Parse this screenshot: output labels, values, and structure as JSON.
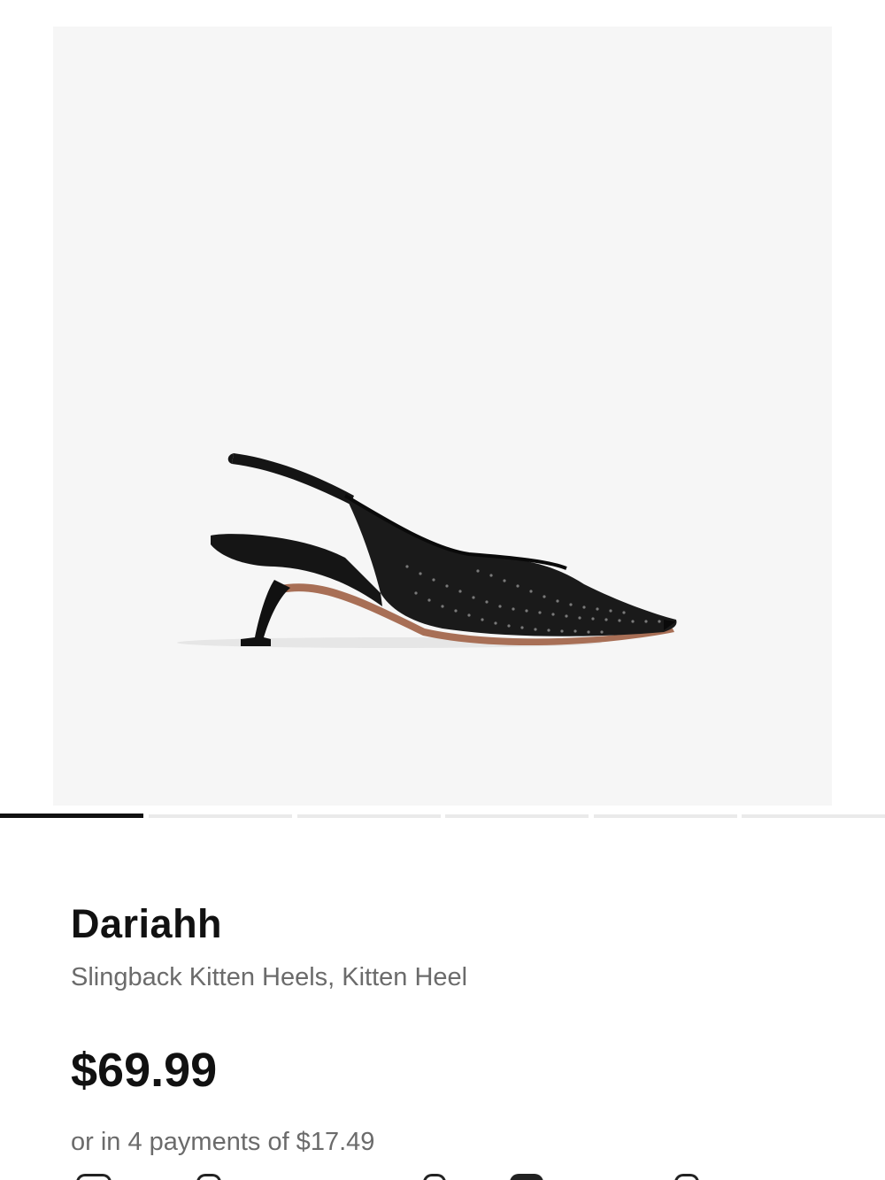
{
  "product": {
    "name": "Dariahh",
    "subtitle": "Slingback Kitten Heels, Kitten Heel",
    "price": "$69.99",
    "installments": "or in 4 payments of $17.49"
  },
  "gallery": {
    "image_icon": "black-mesh-slingback-kitten-heel",
    "total_images": 6,
    "active_image": 1,
    "background_color": "#f6f6f6"
  },
  "colors": {
    "text_primary": "#111111",
    "text_secondary": "#6b6b6b",
    "pager_active": "#111111",
    "pager_inactive": "#eaeaea"
  }
}
